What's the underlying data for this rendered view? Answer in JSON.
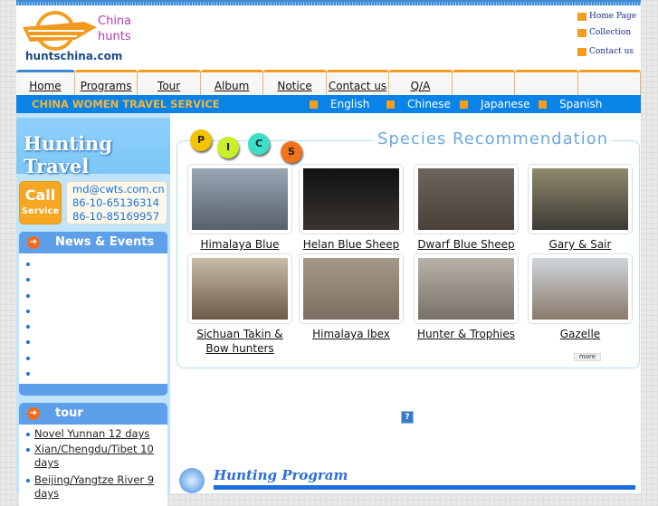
{
  "header": {
    "brand_line1": "China",
    "brand_line2": "hunts",
    "domain": "huntschina.com",
    "links": [
      {
        "label": "Home Page",
        "icon": "home-icon"
      },
      {
        "label": "Collection",
        "icon": "star-folder-icon"
      },
      {
        "label": "Contact us",
        "icon": "envelope-icon"
      }
    ]
  },
  "nav": {
    "tabs": [
      "Home",
      "Programs",
      "Tour",
      "Album",
      "Notice",
      "Contact us",
      "Q/A",
      "",
      "",
      ""
    ]
  },
  "bar": {
    "title": "CHINA WOMEN TRAVEL SERVICE",
    "languages": [
      "English",
      "Chinese",
      "Japanese",
      "Spanish"
    ]
  },
  "sidebar": {
    "banner": "Hunting Travel",
    "call_top": "Call",
    "call_bottom": "Service",
    "contact": [
      "md@cwts.com.cn",
      "86-10-65136314",
      "86-10-85169957"
    ],
    "news_title": "News & Events",
    "news_items": [
      "",
      "",
      "",
      "",
      "",
      "",
      "",
      ""
    ],
    "tour_title": "tour",
    "tour_items": [
      "Novel Yunnan 12 days",
      "Xian/Chengdu/Tibet 10 days",
      "Beijing/Yangtze River 9 days"
    ]
  },
  "species": {
    "title": "Species Recommendation",
    "pics": [
      "P",
      "I",
      "C",
      "S"
    ],
    "items": [
      {
        "caption": "Himalaya Blue Sheep"
      },
      {
        "caption": "Helan Blue Sheep"
      },
      {
        "caption": "Dwarf Blue Sheep"
      },
      {
        "caption": "Gary & Sair"
      },
      {
        "caption": "Sichuan Takin & Bow hunters"
      },
      {
        "caption": "Himalaya Ibex"
      },
      {
        "caption": "Hunter & Trophies"
      },
      {
        "caption": "Gazelle"
      }
    ],
    "more": "more"
  },
  "program": {
    "title": "Hunting Program"
  }
}
